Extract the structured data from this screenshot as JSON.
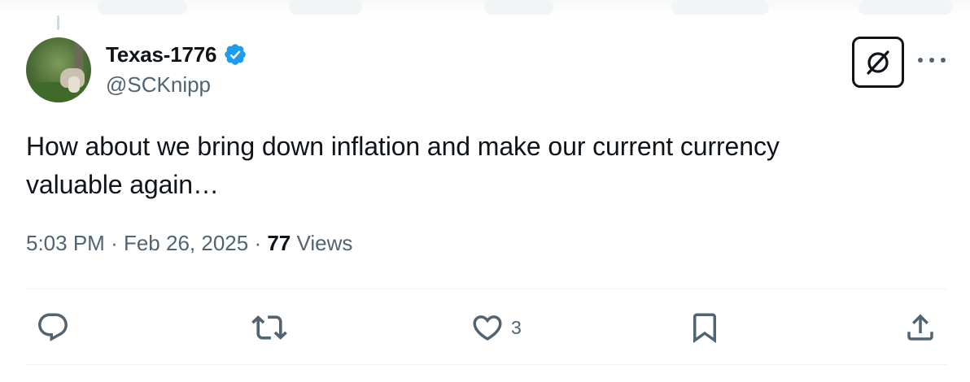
{
  "tweet": {
    "display_name": "Texas-1776",
    "handle": "@SCKnipp",
    "verified": true,
    "text_line1": "How about we bring down inflation and make our current currency",
    "text_line2": "valuable again…",
    "time": "5:03 PM",
    "separator": "·",
    "date": "Feb 26, 2025",
    "views_count": "77",
    "views_label": "Views"
  },
  "actions": {
    "reply_icon": "reply-icon",
    "retweet_icon": "retweet-icon",
    "like_icon": "heart-icon",
    "like_count": "3",
    "bookmark_icon": "bookmark-icon",
    "share_icon": "share-icon"
  },
  "colors": {
    "text": "#0f1419",
    "secondary": "#536471",
    "verified": "#1d9bf0",
    "divider": "#eff3f4"
  }
}
